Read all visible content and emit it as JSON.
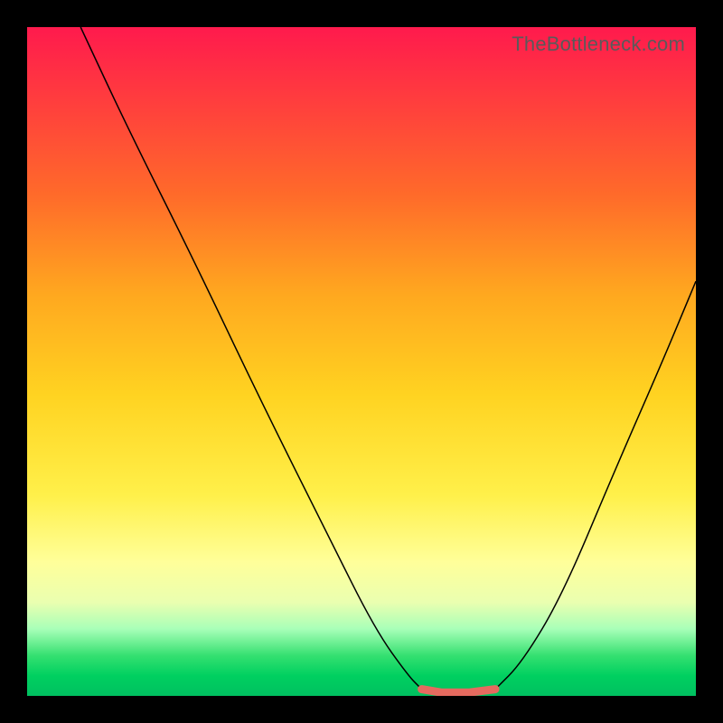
{
  "watermark": "TheBottleneck.com",
  "chart_data": {
    "type": "line",
    "title": "",
    "xlabel": "",
    "ylabel": "",
    "xlim": [
      0,
      100
    ],
    "ylim": [
      0,
      100
    ],
    "grid": false,
    "legend": false,
    "series": [
      {
        "name": "left-curve",
        "x": [
          8,
          15,
          25,
          35,
          45,
          52,
          57,
          59
        ],
        "y": [
          100,
          85,
          65,
          44,
          24,
          10,
          3,
          1
        ]
      },
      {
        "name": "flat-bottom-highlight",
        "x": [
          59,
          62,
          66,
          70
        ],
        "y": [
          1,
          0.5,
          0.5,
          1
        ]
      },
      {
        "name": "right-curve",
        "x": [
          70,
          74,
          80,
          88,
          95,
          100
        ],
        "y": [
          1,
          5,
          15,
          34,
          50,
          62
        ]
      }
    ],
    "colors": {
      "curve": "#000000",
      "highlight": "#e56a5f",
      "gradient_top": "#ff1a4d",
      "gradient_bottom": "#00c060"
    }
  }
}
